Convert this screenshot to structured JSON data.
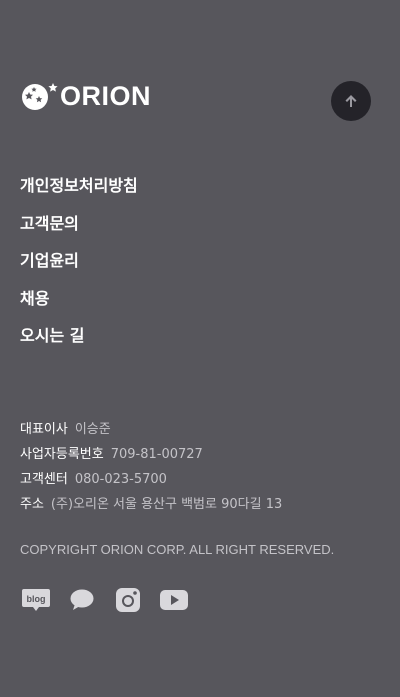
{
  "brand": {
    "name": "ORION",
    "logo_icon": "orion-star-logo-icon"
  },
  "scroll_top": {
    "icon": "arrow-up-icon"
  },
  "nav": {
    "items": [
      {
        "label": "개인정보처리방침"
      },
      {
        "label": "고객문의"
      },
      {
        "label": "기업윤리"
      },
      {
        "label": "채용"
      },
      {
        "label": "오시는 길"
      }
    ]
  },
  "company_info": {
    "ceo_label": "대표이사",
    "ceo_value": "이승준",
    "biz_no_label": "사업자등록번호",
    "biz_no_value": "709-81-00727",
    "cs_label": "고객센터",
    "cs_value": "080-023-5700",
    "address_label": "주소",
    "address_value": "(주)오리온 서울 용산구 백범로 90다길 13"
  },
  "copyright": "COPYRIGHT ORION CORP. ALL RIGHT RESERVED.",
  "sns": {
    "blog_text": "blog",
    "icons": [
      "blog-icon",
      "chat-bubble-icon",
      "instagram-icon",
      "youtube-icon"
    ]
  },
  "colors": {
    "background": "#57565c",
    "top_button": "#242329",
    "muted_text": "#c4c3c8"
  }
}
